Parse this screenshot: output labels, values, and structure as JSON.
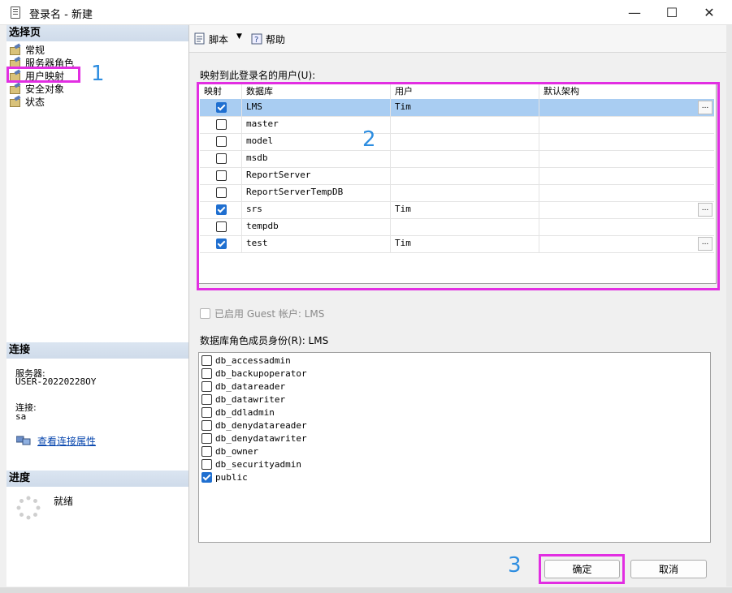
{
  "window": {
    "title": "登录名 - 新建",
    "minimize": "—",
    "maximize": "☐",
    "close": "✕"
  },
  "left": {
    "select_page_header": "选择页",
    "pages": [
      {
        "label": "常规"
      },
      {
        "label": "服务器角色"
      },
      {
        "label": "用户映射"
      },
      {
        "label": "安全对象"
      },
      {
        "label": "状态"
      }
    ],
    "connection_header": "连接",
    "server_label": "服务器:",
    "server_value": "USER-20220228OY",
    "connection_label": "连接:",
    "connection_value": "sa",
    "view_props_link": "查看连接属性",
    "progress_header": "进度",
    "progress_status": "就绪"
  },
  "toolbar": {
    "script_label": "脚本",
    "help_label": "帮助"
  },
  "mapping": {
    "label": "映射到此登录名的用户(U):",
    "columns": [
      "映射",
      "数据库",
      "用户",
      "默认架构"
    ],
    "rows": [
      {
        "mapped": true,
        "database": "LMS",
        "user": "Tim",
        "schema": "",
        "ellipsis": "...",
        "selected": true
      },
      {
        "mapped": false,
        "database": "master",
        "user": "",
        "schema": ""
      },
      {
        "mapped": false,
        "database": "model",
        "user": "",
        "schema": ""
      },
      {
        "mapped": false,
        "database": "msdb",
        "user": "",
        "schema": ""
      },
      {
        "mapped": false,
        "database": "ReportServer",
        "user": "",
        "schema": ""
      },
      {
        "mapped": false,
        "database": "ReportServerTempDB",
        "user": "",
        "schema": ""
      },
      {
        "mapped": true,
        "database": "srs",
        "user": "Tim",
        "schema": "",
        "ellipsis": "..."
      },
      {
        "mapped": false,
        "database": "tempdb",
        "user": "",
        "schema": ""
      },
      {
        "mapped": true,
        "database": "test",
        "user": "Tim",
        "schema": "",
        "ellipsis": "..."
      }
    ]
  },
  "guest_label": "已启用 Guest 帐户: LMS",
  "roles": {
    "label": "数据库角色成员身份(R): LMS",
    "items": [
      {
        "name": "db_accessadmin",
        "checked": false
      },
      {
        "name": "db_backupoperator",
        "checked": false
      },
      {
        "name": "db_datareader",
        "checked": false
      },
      {
        "name": "db_datawriter",
        "checked": false
      },
      {
        "name": "db_ddladmin",
        "checked": false
      },
      {
        "name": "db_denydatareader",
        "checked": false
      },
      {
        "name": "db_denydatawriter",
        "checked": false
      },
      {
        "name": "db_owner",
        "checked": false
      },
      {
        "name": "db_securityadmin",
        "checked": false
      },
      {
        "name": "public",
        "checked": true
      }
    ]
  },
  "buttons": {
    "ok": "确定",
    "cancel": "取消"
  },
  "annotations": [
    "1",
    "2",
    "3"
  ],
  "colors": {
    "highlight": "#e22ee2",
    "annotation": "#2d8de0",
    "selected_row": "#a9cdf2",
    "check": "#1f6fd0"
  }
}
